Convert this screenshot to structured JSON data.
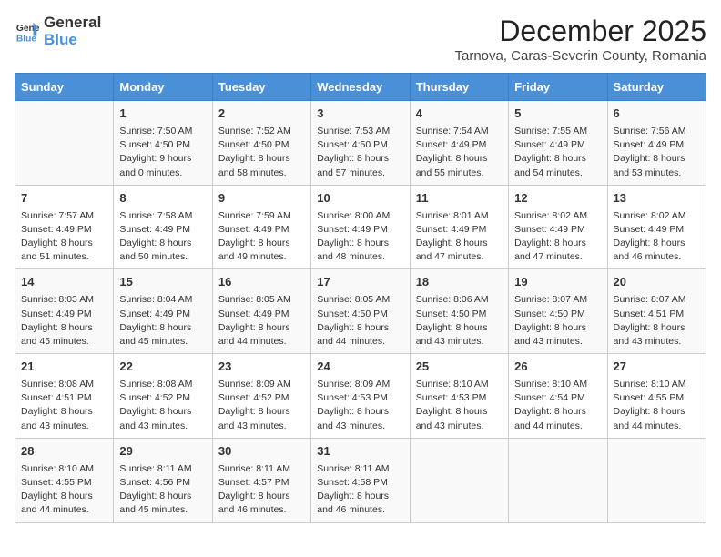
{
  "header": {
    "logo_general": "General",
    "logo_blue": "Blue",
    "main_title": "December 2025",
    "subtitle": "Tarnova, Caras-Severin County, Romania"
  },
  "calendar": {
    "days_of_week": [
      "Sunday",
      "Monday",
      "Tuesday",
      "Wednesday",
      "Thursday",
      "Friday",
      "Saturday"
    ],
    "weeks": [
      [
        {
          "day": "",
          "content": ""
        },
        {
          "day": "1",
          "content": "Sunrise: 7:50 AM\nSunset: 4:50 PM\nDaylight: 9 hours\nand 0 minutes."
        },
        {
          "day": "2",
          "content": "Sunrise: 7:52 AM\nSunset: 4:50 PM\nDaylight: 8 hours\nand 58 minutes."
        },
        {
          "day": "3",
          "content": "Sunrise: 7:53 AM\nSunset: 4:50 PM\nDaylight: 8 hours\nand 57 minutes."
        },
        {
          "day": "4",
          "content": "Sunrise: 7:54 AM\nSunset: 4:49 PM\nDaylight: 8 hours\nand 55 minutes."
        },
        {
          "day": "5",
          "content": "Sunrise: 7:55 AM\nSunset: 4:49 PM\nDaylight: 8 hours\nand 54 minutes."
        },
        {
          "day": "6",
          "content": "Sunrise: 7:56 AM\nSunset: 4:49 PM\nDaylight: 8 hours\nand 53 minutes."
        }
      ],
      [
        {
          "day": "7",
          "content": "Sunrise: 7:57 AM\nSunset: 4:49 PM\nDaylight: 8 hours\nand 51 minutes."
        },
        {
          "day": "8",
          "content": "Sunrise: 7:58 AM\nSunset: 4:49 PM\nDaylight: 8 hours\nand 50 minutes."
        },
        {
          "day": "9",
          "content": "Sunrise: 7:59 AM\nSunset: 4:49 PM\nDaylight: 8 hours\nand 49 minutes."
        },
        {
          "day": "10",
          "content": "Sunrise: 8:00 AM\nSunset: 4:49 PM\nDaylight: 8 hours\nand 48 minutes."
        },
        {
          "day": "11",
          "content": "Sunrise: 8:01 AM\nSunset: 4:49 PM\nDaylight: 8 hours\nand 47 minutes."
        },
        {
          "day": "12",
          "content": "Sunrise: 8:02 AM\nSunset: 4:49 PM\nDaylight: 8 hours\nand 47 minutes."
        },
        {
          "day": "13",
          "content": "Sunrise: 8:02 AM\nSunset: 4:49 PM\nDaylight: 8 hours\nand 46 minutes."
        }
      ],
      [
        {
          "day": "14",
          "content": "Sunrise: 8:03 AM\nSunset: 4:49 PM\nDaylight: 8 hours\nand 45 minutes."
        },
        {
          "day": "15",
          "content": "Sunrise: 8:04 AM\nSunset: 4:49 PM\nDaylight: 8 hours\nand 45 minutes."
        },
        {
          "day": "16",
          "content": "Sunrise: 8:05 AM\nSunset: 4:49 PM\nDaylight: 8 hours\nand 44 minutes."
        },
        {
          "day": "17",
          "content": "Sunrise: 8:05 AM\nSunset: 4:50 PM\nDaylight: 8 hours\nand 44 minutes."
        },
        {
          "day": "18",
          "content": "Sunrise: 8:06 AM\nSunset: 4:50 PM\nDaylight: 8 hours\nand 43 minutes."
        },
        {
          "day": "19",
          "content": "Sunrise: 8:07 AM\nSunset: 4:50 PM\nDaylight: 8 hours\nand 43 minutes."
        },
        {
          "day": "20",
          "content": "Sunrise: 8:07 AM\nSunset: 4:51 PM\nDaylight: 8 hours\nand 43 minutes."
        }
      ],
      [
        {
          "day": "21",
          "content": "Sunrise: 8:08 AM\nSunset: 4:51 PM\nDaylight: 8 hours\nand 43 minutes."
        },
        {
          "day": "22",
          "content": "Sunrise: 8:08 AM\nSunset: 4:52 PM\nDaylight: 8 hours\nand 43 minutes."
        },
        {
          "day": "23",
          "content": "Sunrise: 8:09 AM\nSunset: 4:52 PM\nDaylight: 8 hours\nand 43 minutes."
        },
        {
          "day": "24",
          "content": "Sunrise: 8:09 AM\nSunset: 4:53 PM\nDaylight: 8 hours\nand 43 minutes."
        },
        {
          "day": "25",
          "content": "Sunrise: 8:10 AM\nSunset: 4:53 PM\nDaylight: 8 hours\nand 43 minutes."
        },
        {
          "day": "26",
          "content": "Sunrise: 8:10 AM\nSunset: 4:54 PM\nDaylight: 8 hours\nand 44 minutes."
        },
        {
          "day": "27",
          "content": "Sunrise: 8:10 AM\nSunset: 4:55 PM\nDaylight: 8 hours\nand 44 minutes."
        }
      ],
      [
        {
          "day": "28",
          "content": "Sunrise: 8:10 AM\nSunset: 4:55 PM\nDaylight: 8 hours\nand 44 minutes."
        },
        {
          "day": "29",
          "content": "Sunrise: 8:11 AM\nSunset: 4:56 PM\nDaylight: 8 hours\nand 45 minutes."
        },
        {
          "day": "30",
          "content": "Sunrise: 8:11 AM\nSunset: 4:57 PM\nDaylight: 8 hours\nand 46 minutes."
        },
        {
          "day": "31",
          "content": "Sunrise: 8:11 AM\nSunset: 4:58 PM\nDaylight: 8 hours\nand 46 minutes."
        },
        {
          "day": "",
          "content": ""
        },
        {
          "day": "",
          "content": ""
        },
        {
          "day": "",
          "content": ""
        }
      ]
    ]
  }
}
